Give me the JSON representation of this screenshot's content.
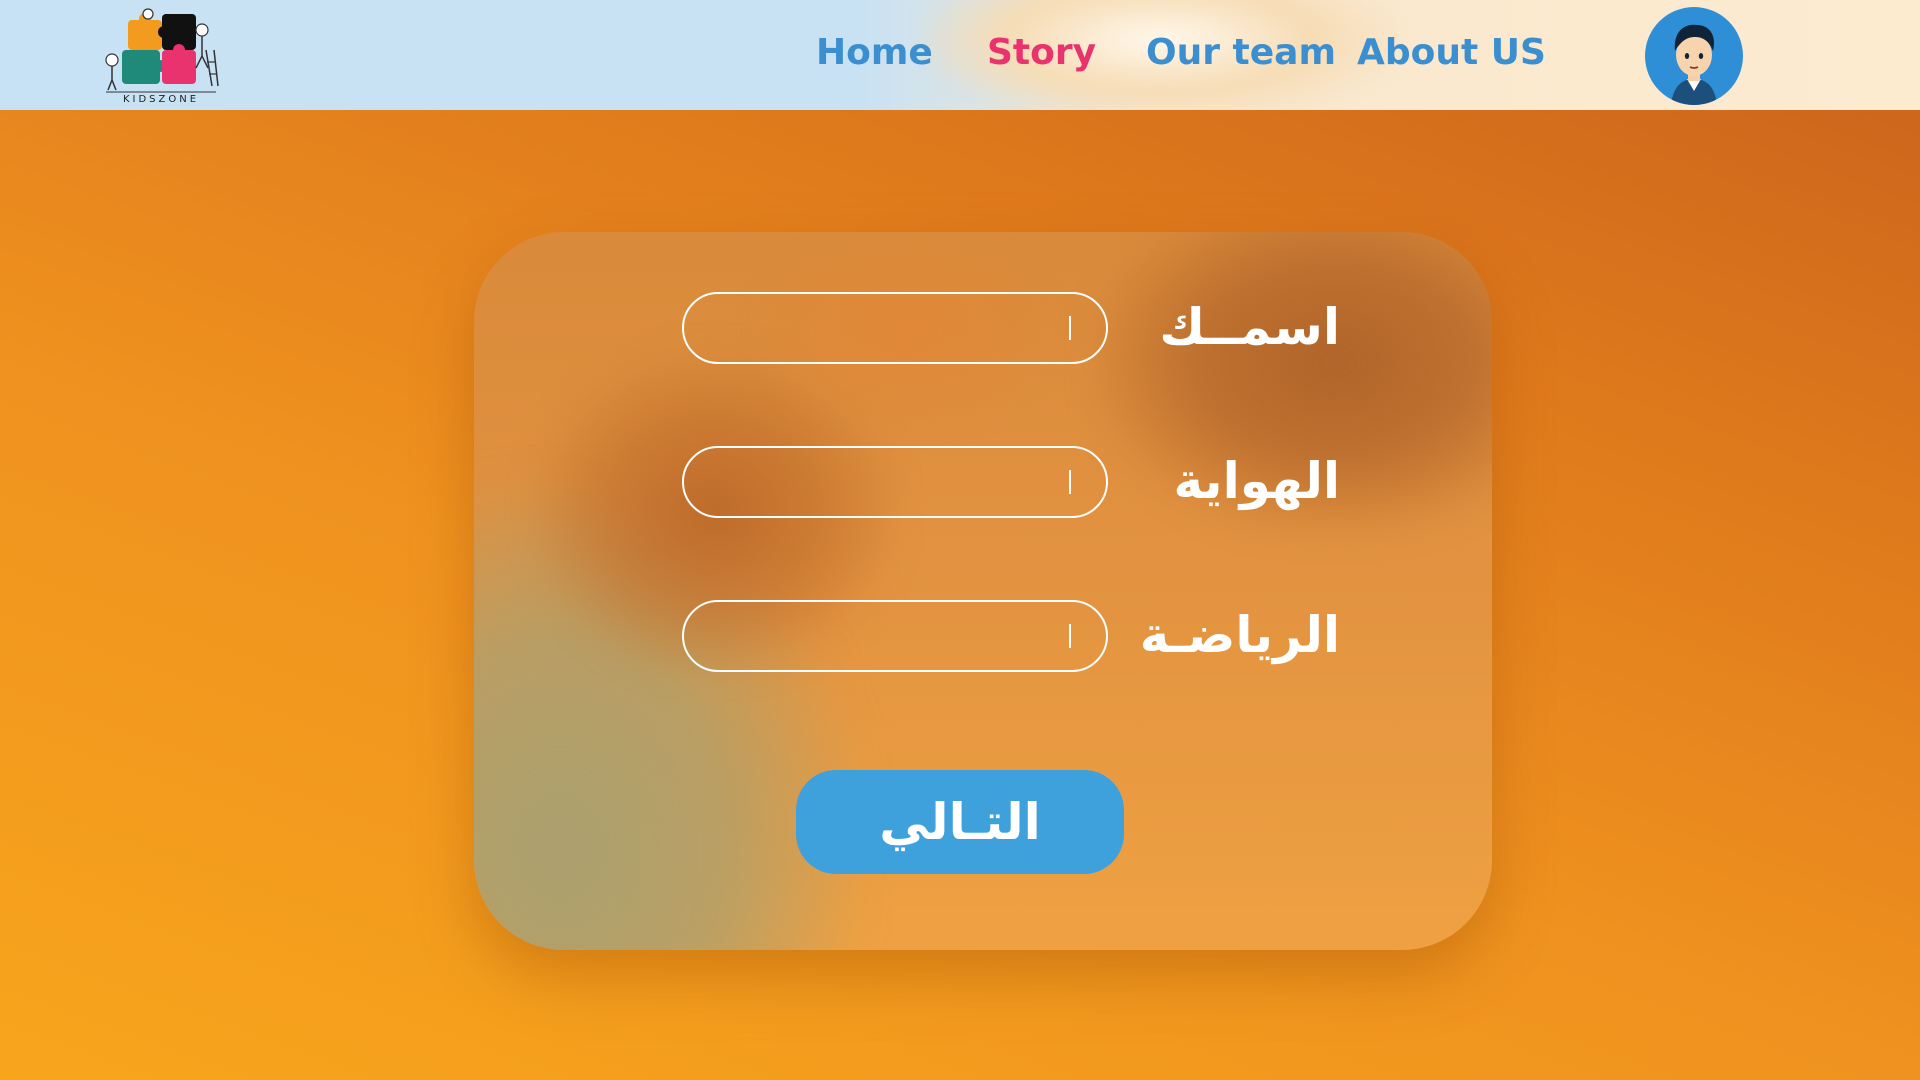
{
  "header": {
    "logo_text": "KIDSZONE",
    "nav": {
      "home": "Home",
      "story": "Story",
      "team": "Our team",
      "about": "About US"
    },
    "active_color": "#e8336f",
    "nav_color": "#3b8fd0"
  },
  "form": {
    "fields": [
      {
        "label": "اسمــك",
        "value": ""
      },
      {
        "label": "الهواية",
        "value": ""
      },
      {
        "label": "الرياضـة",
        "value": ""
      }
    ],
    "next_label": "التـالي"
  },
  "icons": {
    "avatar": "boy-avatar-icon",
    "logo": "puzzle-logo-icon"
  }
}
